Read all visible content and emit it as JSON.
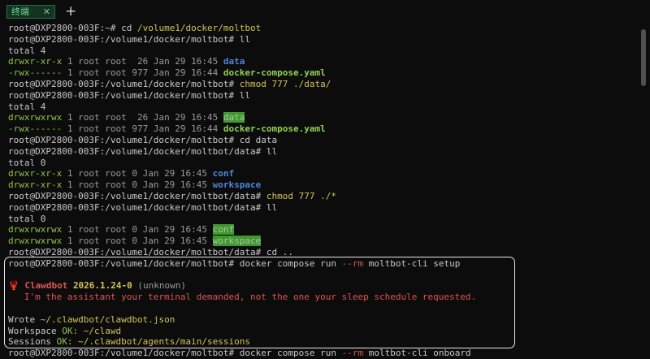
{
  "tabbar": {
    "tab_label": "终端",
    "close_glyph": "✕",
    "new_tab_glyph": "+"
  },
  "prompts": {
    "home": "root@DXP2800-003F:~# ",
    "moltbot": "root@DXP2800-003F:/volume1/docker/moltbot# ",
    "moltbot_data": "root@DXP2800-003F:/volume1/docker/moltbot/data# "
  },
  "lines": {
    "l1_cmd": "cd ",
    "l1_arg": "/volume1/docker/moltbot",
    "l2_cmd": "ll",
    "l3": "total 4",
    "l4_perm": "drwxr-xr-x",
    "l4_mid": " 1 root root  26 Jan 29 16:45 ",
    "l4_name": "data",
    "l5_perm": "-rwx------",
    "l5_mid": " 1 root root 977 Jan 29 16:44 ",
    "l5_name": "docker-compose.yaml",
    "l6_cmd": "chmod 777 ./data/",
    "l7_cmd": "ll",
    "l8": "total 4",
    "l9_perm": "drwxrwxrwx",
    "l9_mid": " 1 root root  26 Jan 29 16:45 ",
    "l9_name": "data",
    "l10_perm": "-rwx------",
    "l10_mid": " 1 root root 977 Jan 29 16:44 ",
    "l10_name": "docker-compose.yaml",
    "l11_cmd": "cd data",
    "l12_cmd": "ll",
    "l13": "total 0",
    "l14_perm": "drwxr-xr-x",
    "l14_mid": " 1 root root 0 Jan 29 16:45 ",
    "l14_name": "conf",
    "l15_perm": "drwxr-xr-x",
    "l15_mid": " 1 root root 0 Jan 29 16:45 ",
    "l15_name": "workspace",
    "l16_cmd": "chmod 777 ./*",
    "l17_cmd": "ll",
    "l18": "total 0",
    "l19_perm": "drwxrwxrwx",
    "l19_mid": " 1 root root 0 Jan 29 16:45 ",
    "l19_name": "conf",
    "l20_perm": "drwxrwxrwx",
    "l20_mid": " 1 root root 0 Jan 29 16:45 ",
    "l20_name": "workspace",
    "l21_cmd": "cd ..",
    "l22_cmd1": "docker compose run ",
    "l22_flag": "--rm",
    "l22_cmd2": " moltbot-cli setup",
    "l24_icon": "🦞",
    "l24_name": "Clawdbot",
    "l24_version": "2026.1.24-0",
    "l24_extra": " (unknown)",
    "l25_tagline": "   I'm the assistant your terminal demanded, not the one your sleep schedule requested.",
    "l27_a": "Wrote ",
    "l27_path": "~/.clawdbot/clawdbot.json",
    "l28_a": "Workspace ",
    "l28_ok": "OK",
    "l28_path": ": ~/clawd",
    "l29_a": "Sessions ",
    "l29_ok": "OK",
    "l29_path": ": ~/.clawdbot/agents/main/sessions",
    "l30_cmd1": "docker compose run ",
    "l30_flag": "--rm",
    "l30_cmd2": " moltbot-cli onboard"
  }
}
